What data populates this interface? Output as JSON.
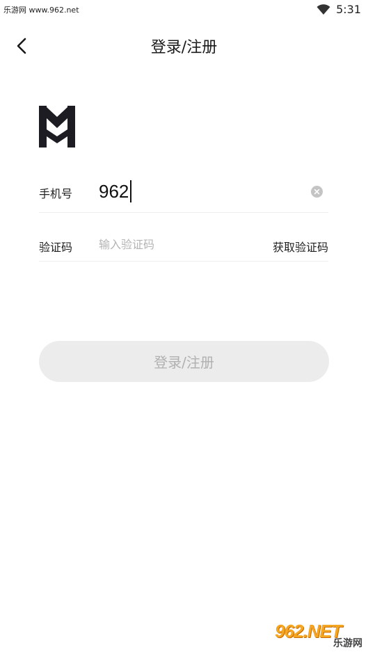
{
  "status_bar": {
    "left_text": "乐游网 www.962.net",
    "time": "5:31",
    "wifi_icon": "wifi-icon"
  },
  "header": {
    "title": "登录/注册",
    "back_icon": "chevron-left-icon"
  },
  "logo": {
    "icon": "m-logo-icon",
    "color": "#1c1c22"
  },
  "phone_field": {
    "label": "手机号",
    "value": "962",
    "clear_icon": "clear-circle-icon"
  },
  "code_field": {
    "label": "验证码",
    "placeholder": "输入验证码",
    "get_code_label": "获取验证码"
  },
  "submit": {
    "label": "登录/注册",
    "background": "#ececec",
    "text_color": "#b0b0b0"
  },
  "watermark": {
    "big": "962.NET",
    "small": "乐游网"
  }
}
